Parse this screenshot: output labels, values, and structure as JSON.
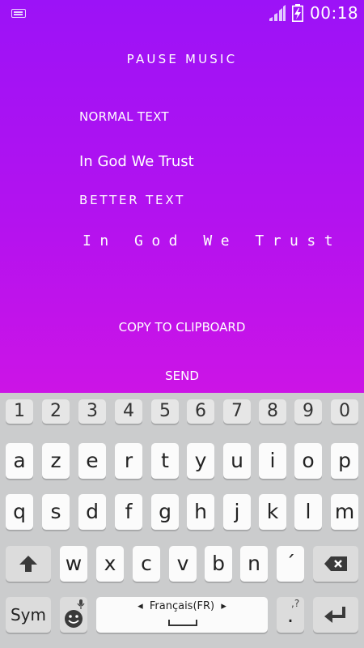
{
  "status_bar": {
    "time": "00:18",
    "icons": [
      "keyboard-icon",
      "signal-icon",
      "battery-charging-icon"
    ]
  },
  "app": {
    "pause_button": "PAUSE MUSIC",
    "normal_label": "NORMAL TEXT",
    "normal_text": "In God We Trust",
    "better_label": "BETTER TEXT",
    "better_text": "In God We Trust",
    "copy_button": "COPY TO CLIPBOARD",
    "send_button": "SEND",
    "colors": {
      "gradient_top": "#9c12f7",
      "gradient_bottom": "#cc14e6"
    }
  },
  "keyboard": {
    "number_row": [
      "1",
      "2",
      "3",
      "4",
      "5",
      "6",
      "7",
      "8",
      "9",
      "0"
    ],
    "row1": [
      "a",
      "z",
      "e",
      "r",
      "t",
      "y",
      "u",
      "i",
      "o",
      "p"
    ],
    "row2": [
      "q",
      "s",
      "d",
      "f",
      "g",
      "h",
      "j",
      "k",
      "l",
      "m"
    ],
    "row3": [
      "w",
      "x",
      "c",
      "v",
      "b",
      "n",
      "´"
    ],
    "sym_label": "Sym",
    "language": "Français(FR)",
    "punct_top": ",?",
    "punct_bottom": "."
  }
}
